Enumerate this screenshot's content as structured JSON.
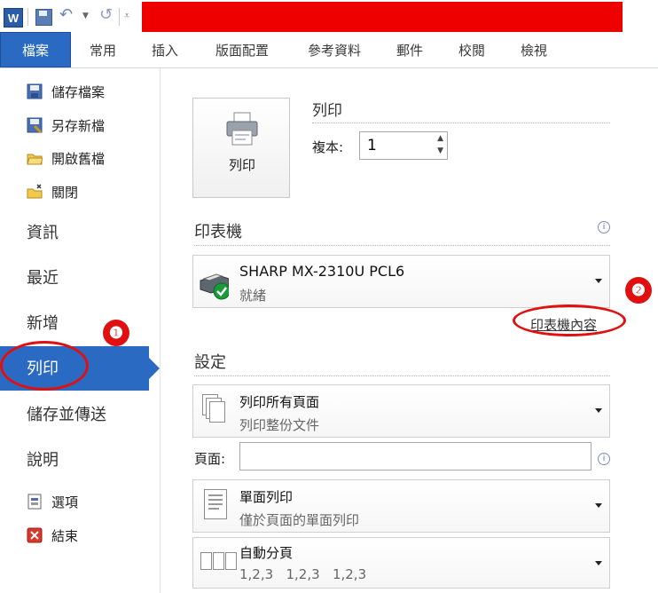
{
  "app": {
    "logo_letter": "W"
  },
  "ribbon": {
    "tabs": [
      "檔案",
      "常用",
      "插入",
      "版面配置",
      "參考資料",
      "郵件",
      "校閱",
      "檢視"
    ]
  },
  "backstage_nav": {
    "commands": [
      {
        "label": "儲存檔案",
        "icon": "save-icon"
      },
      {
        "label": "另存新檔",
        "icon": "save-as-icon"
      },
      {
        "label": "開啟舊檔",
        "icon": "open-folder-icon"
      },
      {
        "label": "關閉",
        "icon": "close-folder-icon"
      }
    ],
    "sections": [
      "資訊",
      "最近",
      "新增",
      "列印",
      "儲存並傳送",
      "說明"
    ],
    "active": "列印",
    "footer": [
      {
        "label": "選項",
        "icon": "options-icon"
      },
      {
        "label": "結束",
        "icon": "exit-icon"
      }
    ]
  },
  "print": {
    "button_label": "列印",
    "heading": "列印",
    "copies_label": "複本:",
    "copies_value": "1"
  },
  "printer": {
    "heading": "印表機",
    "name": "SHARP MX-2310U PCL6",
    "status": "就緒",
    "properties_link": "印表機內容"
  },
  "settings": {
    "heading": "設定",
    "range": {
      "title": "列印所有頁面",
      "desc": "列印整份文件"
    },
    "pages_label": "頁面:",
    "pages_value": "",
    "sides": {
      "title": "單面列印",
      "desc": "僅於頁面的單面列印"
    },
    "collate": {
      "title": "自動分頁",
      "desc": "1,2,3   1,2,3   1,2,3"
    }
  },
  "annotations": {
    "badge_1": "❶",
    "badge_2": "❷"
  },
  "colors": {
    "accent": "#2b6ac2",
    "annotation": "#e01010",
    "title_redaction": "#ee0000"
  }
}
